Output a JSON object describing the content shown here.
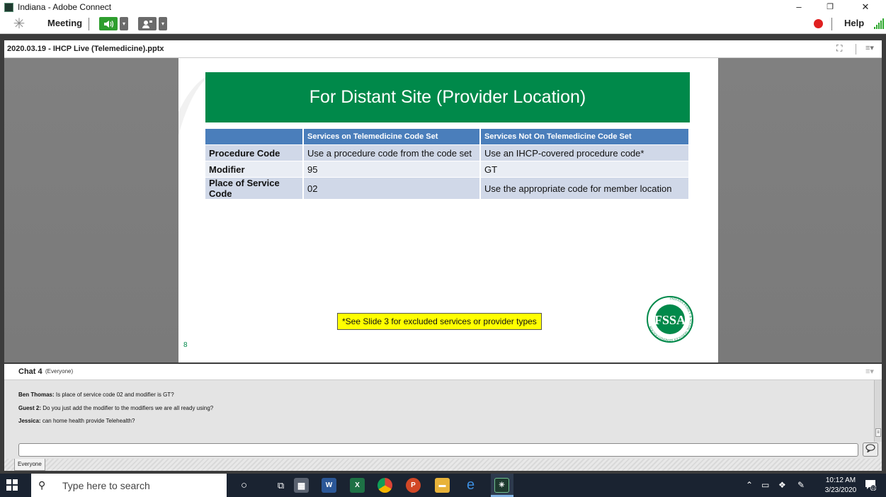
{
  "window": {
    "title": "Indiana - Adobe Connect",
    "minimize": "–",
    "maximize": "❐",
    "close": "✕"
  },
  "menubar": {
    "meeting_label": "Meeting",
    "help_label": "Help"
  },
  "share_pod": {
    "title": "2020.03.19 - IHCP Live (Telemedicine).pptx",
    "menu_glyph": "≡▾"
  },
  "slide": {
    "title": "For Distant Site (Provider Location)",
    "table": {
      "headers": [
        "",
        "Services on Telemedicine Code Set",
        "Services Not On Telemedicine Code Set"
      ],
      "rows": [
        [
          "Procedure Code",
          "Use a procedure code from the code set",
          "Use an IHCP-covered procedure code*"
        ],
        [
          "Modifier",
          "95",
          "GT"
        ],
        [
          "Place of Service Code",
          "02",
          "Use the appropriate code for member location"
        ]
      ]
    },
    "note": "*See Slide 3 for excluded services or provider types",
    "slide_number": "8",
    "logo_text": "FSSA",
    "logo_ring_text": "INDIANA FAMILY & SOCIAL SERVICES ADMINISTRATION"
  },
  "chat": {
    "title": "Chat 4",
    "audience": "(Everyone)",
    "messages": [
      {
        "sender": "Ben Thomas:",
        "text": " Is place of service code 02 and modifier is GT?"
      },
      {
        "sender": "Guest 2:",
        "text": " Do you just add the modifier to the modifiers we are all ready using?"
      },
      {
        "sender": "Jessica:",
        "text": " can home health provide Telehealth?"
      }
    ],
    "input_value": "",
    "tab_label": "Everyone"
  },
  "taskbar": {
    "search_placeholder": "Type here to search",
    "time": "10:12 AM",
    "date": "3/23/2020",
    "notification_count": "11"
  },
  "colors": {
    "slide_green": "#00894a",
    "table_header_blue": "#4a7ebb",
    "speaker_active": "#2e9e2e",
    "record_red": "#e02020"
  }
}
